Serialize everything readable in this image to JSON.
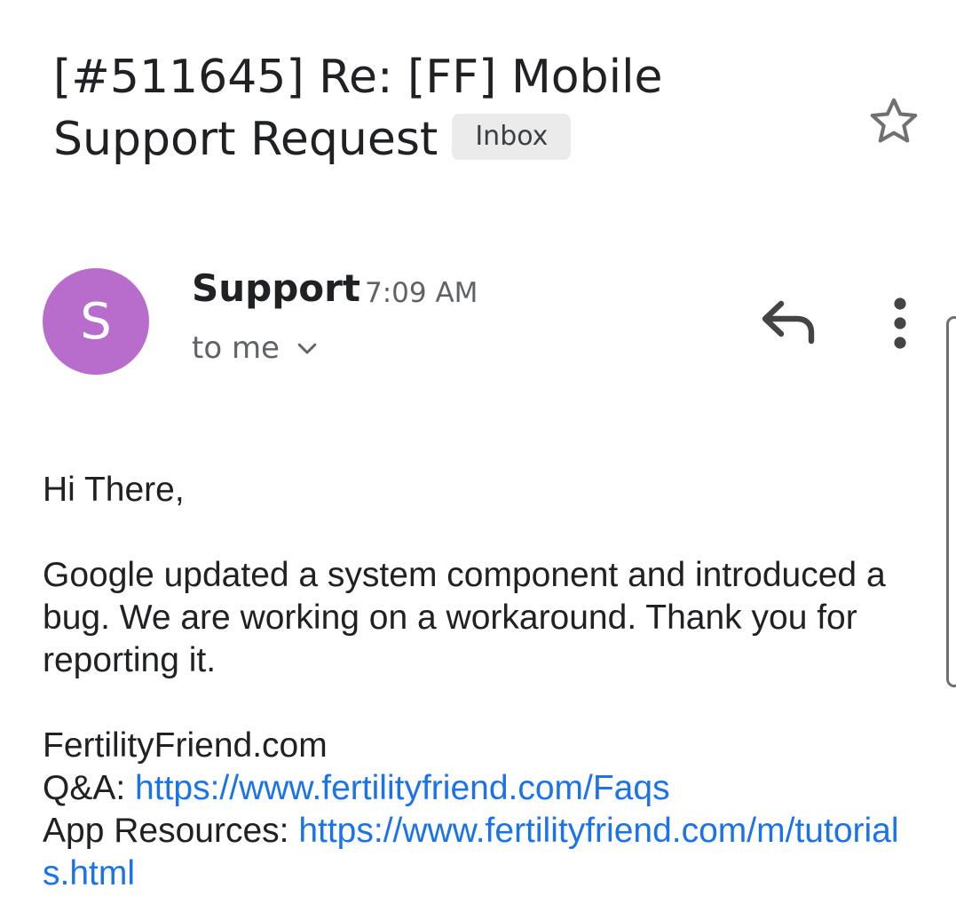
{
  "email": {
    "subject_line1": "[#511645] Re: [FF] Mobile",
    "subject_line2": "Support Request",
    "label": "Inbox",
    "star_icon": "star-outline-icon"
  },
  "sender": {
    "avatar_letter": "S",
    "avatar_color": "#b86ccb",
    "name": "Support",
    "time": "7:09 AM",
    "recipients": "to me",
    "reply_icon": "reply-icon",
    "more_icon": "more-vert-icon"
  },
  "body": {
    "greeting": "Hi There,",
    "message": "Google updated a system component and introduced a bug. We are working on a workaround. Thank you for reporting it.",
    "signature": "FertilityFriend.com",
    "qa_label": "Q&A: ",
    "qa_link": "https://www.fertilityfriend.com/Faqs",
    "resources_label": "App Resources: ",
    "resources_link": "https://www.fertilityfriend.com/m/tutorials.html"
  },
  "colors": {
    "link": "#1a73e8",
    "text": "#202124",
    "secondary": "#5f6368",
    "chip_bg": "#ebebeb"
  }
}
